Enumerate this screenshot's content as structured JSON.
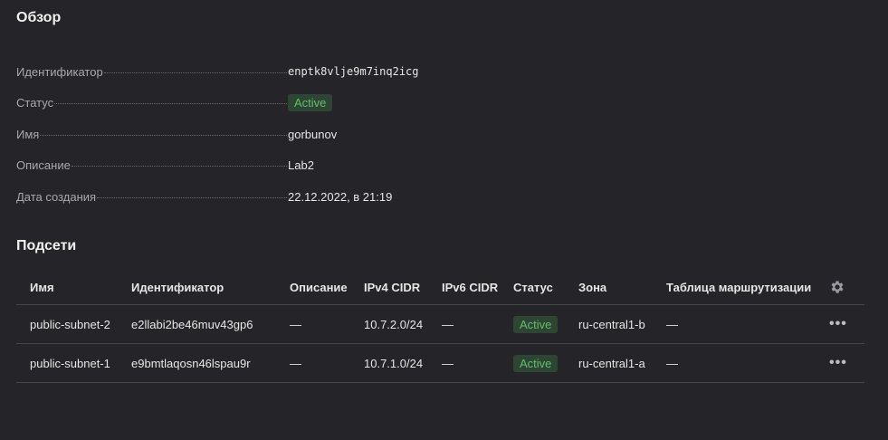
{
  "overview": {
    "title": "Обзор",
    "props": [
      {
        "key": "Идентификатор",
        "value": "enptk8vlje9m7inq2icg"
      },
      {
        "key": "Статус",
        "value": "Active"
      },
      {
        "key": "Имя",
        "value": "gorbunov"
      },
      {
        "key": "Описание",
        "value": "Lab2"
      },
      {
        "key": "Дата создания",
        "value": "22.12.2022, в 21:19"
      }
    ]
  },
  "subnets": {
    "title": "Подсети",
    "columns": [
      "Имя",
      "Идентификатор",
      "Описание",
      "IPv4 CIDR",
      "IPv6 CIDR",
      "Статус",
      "Зона",
      "Таблица маршрутизации"
    ],
    "settings_icon": "gear-icon",
    "rows": [
      {
        "name": "public-subnet-2",
        "id": "e2llabi2be46muv43gp6",
        "description": "—",
        "ipv4": "10.7.2.0/24",
        "ipv6": "—",
        "status": "Active",
        "zone": "ru-central1-b",
        "route_table": "—",
        "menu": "•••"
      },
      {
        "name": "public-subnet-1",
        "id": "e9bmtlaqosn46lspau9r",
        "description": "—",
        "ipv4": "10.7.1.0/24",
        "ipv6": "—",
        "status": "Active",
        "zone": "ru-central1-a",
        "route_table": "—",
        "menu": "•••"
      }
    ]
  },
  "colors": {
    "background": "#252529",
    "status_active_bg": "#2f4533",
    "status_active_text": "#5fbf6a"
  }
}
